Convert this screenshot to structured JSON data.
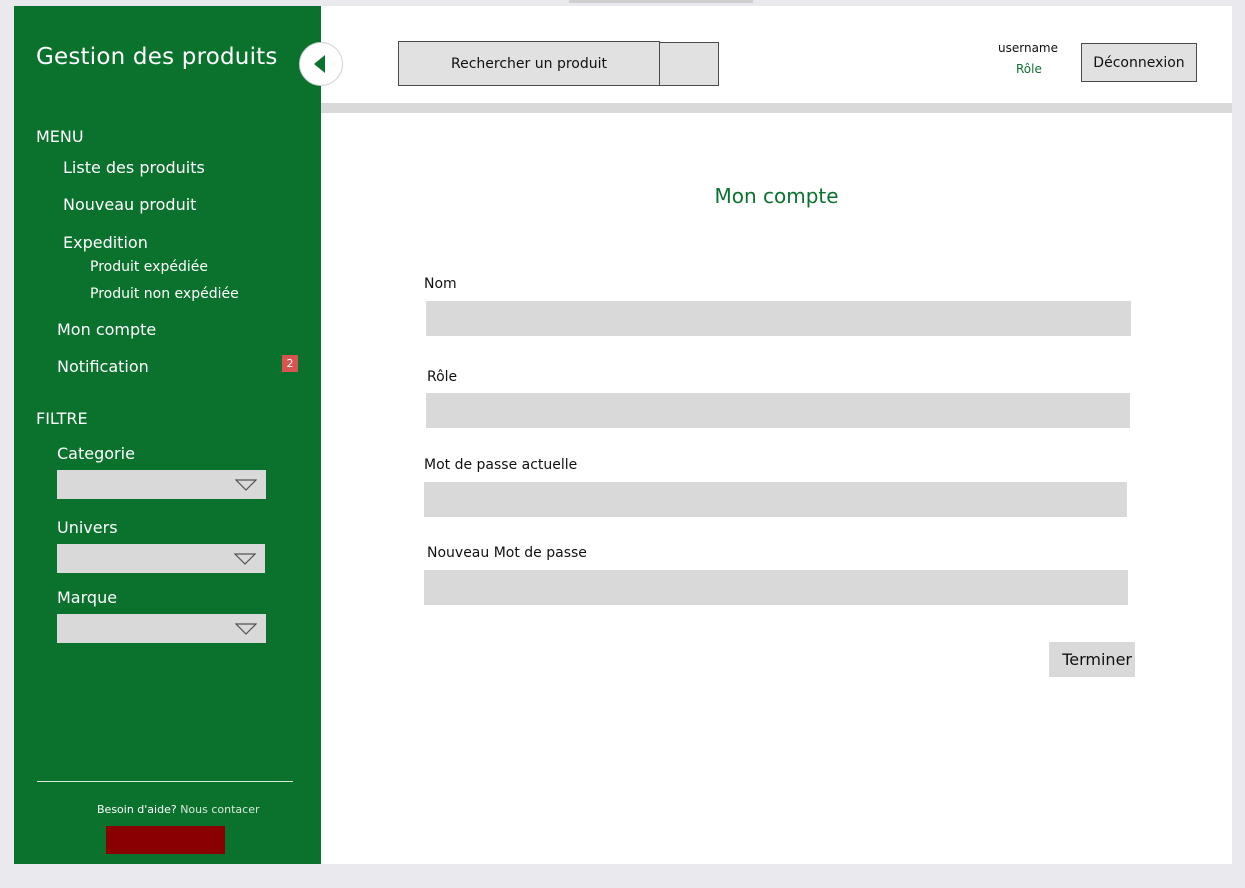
{
  "sidebar": {
    "title": "Gestion des produits",
    "menu_label": "MENU",
    "items": [
      {
        "label": "Liste des produits"
      },
      {
        "label": "Nouveau produit"
      },
      {
        "label": "Expedition"
      },
      {
        "label": "Produit expédiée"
      },
      {
        "label": "Produit non expédiée"
      },
      {
        "label": "Mon compte"
      },
      {
        "label": "Notification"
      }
    ],
    "notification_count": "2",
    "filter_label": "FILTRE",
    "filters": [
      {
        "label": "Categorie"
      },
      {
        "label": "Univers"
      },
      {
        "label": "Marque"
      }
    ],
    "help_text": "Besoin d'aide?",
    "help_link": "Nous contacer"
  },
  "header": {
    "search_label": "Rechercher un produit",
    "username": "username",
    "role": "Rôle",
    "logout_label": "Déconnexion"
  },
  "main": {
    "title": "Mon compte",
    "fields": [
      {
        "label": "Nom",
        "value": ""
      },
      {
        "label": "Rôle",
        "value": ""
      },
      {
        "label": "Mot de passe actuelle",
        "value": ""
      },
      {
        "label": "Nouveau Mot de passe",
        "value": ""
      }
    ],
    "finish_label": "Terminer"
  },
  "colors": {
    "brand_green": "#0b722e",
    "badge_red": "#d9534f",
    "dark_red": "#8a0000",
    "field_gray": "#d9d9d9"
  }
}
